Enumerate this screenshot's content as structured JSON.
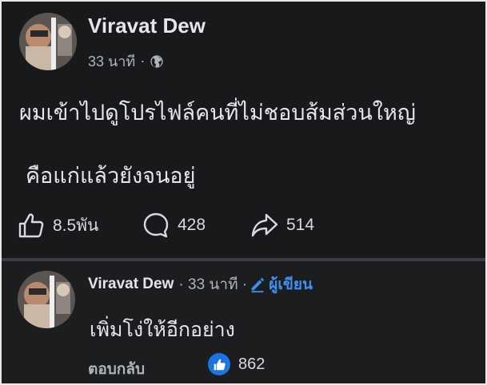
{
  "post": {
    "author": "Viravat Dew",
    "time": "33 นาที",
    "separator": "·",
    "privacy_icon": "globe-icon",
    "lines": [
      "ผมเข้าไปดูโปรไฟล์คนที่ไม่ชอบส้มส่วนใหญ่",
      "คือแก่แล้วยังจนอยู่"
    ],
    "reactions": "8.5พัน",
    "comments": "428",
    "shares": "514"
  },
  "comment": {
    "author": "Viravat Dew",
    "time": "· 33 นาที ·",
    "author_badge": "ผู้เขียน",
    "text": "เพิ่มโง่ให้อีกอย่าง",
    "reply_label": "ตอบกลับ",
    "likes": "862"
  },
  "colors": {
    "background": "#18191a",
    "text": "#e4e6eb",
    "secondary_text": "#b0b3b8",
    "accent": "#1b74e4",
    "author_badge": "#3e8ff0"
  }
}
